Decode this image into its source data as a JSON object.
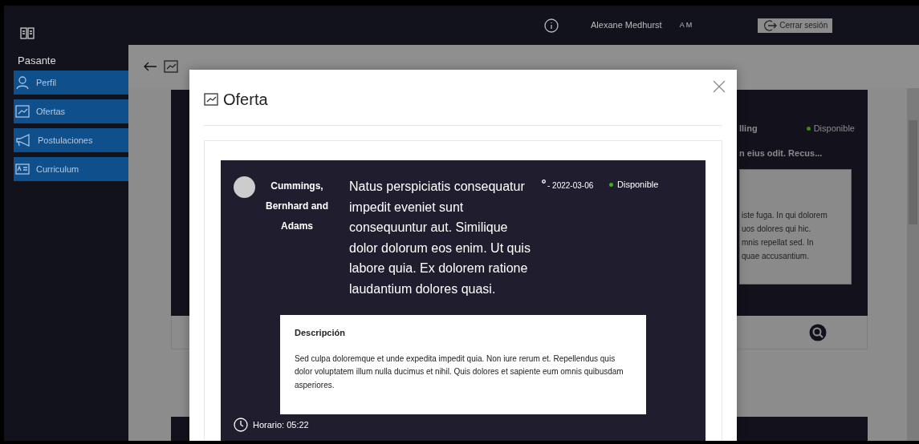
{
  "sidebar": {
    "role": "Pasante",
    "items": [
      {
        "label": "Perfil",
        "kind": "profile",
        "selected": false
      },
      {
        "label": "Ofertas",
        "kind": "offers",
        "selected": false
      },
      {
        "label": "Postulaciones",
        "kind": "applications",
        "selected": false
      },
      {
        "label": "Curriculum",
        "kind": "resume",
        "selected": false
      }
    ]
  },
  "topbar": {
    "user_name": "Alexane Medhurst",
    "initials": "A M",
    "logout_label": "Cerrar sesión"
  },
  "background_page": {
    "offer_card": {
      "company_fragment": "lling",
      "status": "Disponible",
      "available": true,
      "title_fragment": "n eius odit. Recus...",
      "description_lines": [
        "iste fuga. In qui dolorem",
        "uos dolores qui hic.",
        "mnis repellat sed. In",
        "quae accusantium."
      ]
    }
  },
  "modal": {
    "title": "Oferta",
    "offer": {
      "company": "Cummings, Bernhard and Adams",
      "title": "Natus perspiciatis consequatur impedit eveniet sunt consequuntur aut. Similique dolor dolorum eos enim. Ut quis labore quia. Ex dolorem ratione laudantium dolores quasi.",
      "date": "- 2022-03-06",
      "status": "Disponible",
      "available": true,
      "description_heading": "Descripción",
      "description": "Sed culpa doloremque et unde expedita impedit quia. Non iure rerum et. Repellendus quis dolor voluptatem illum nulla ducimus et nihil. Quis dolores et sapiente eum omnis quibusdam asperiores.",
      "schedule": "Horario: 05:22"
    }
  }
}
